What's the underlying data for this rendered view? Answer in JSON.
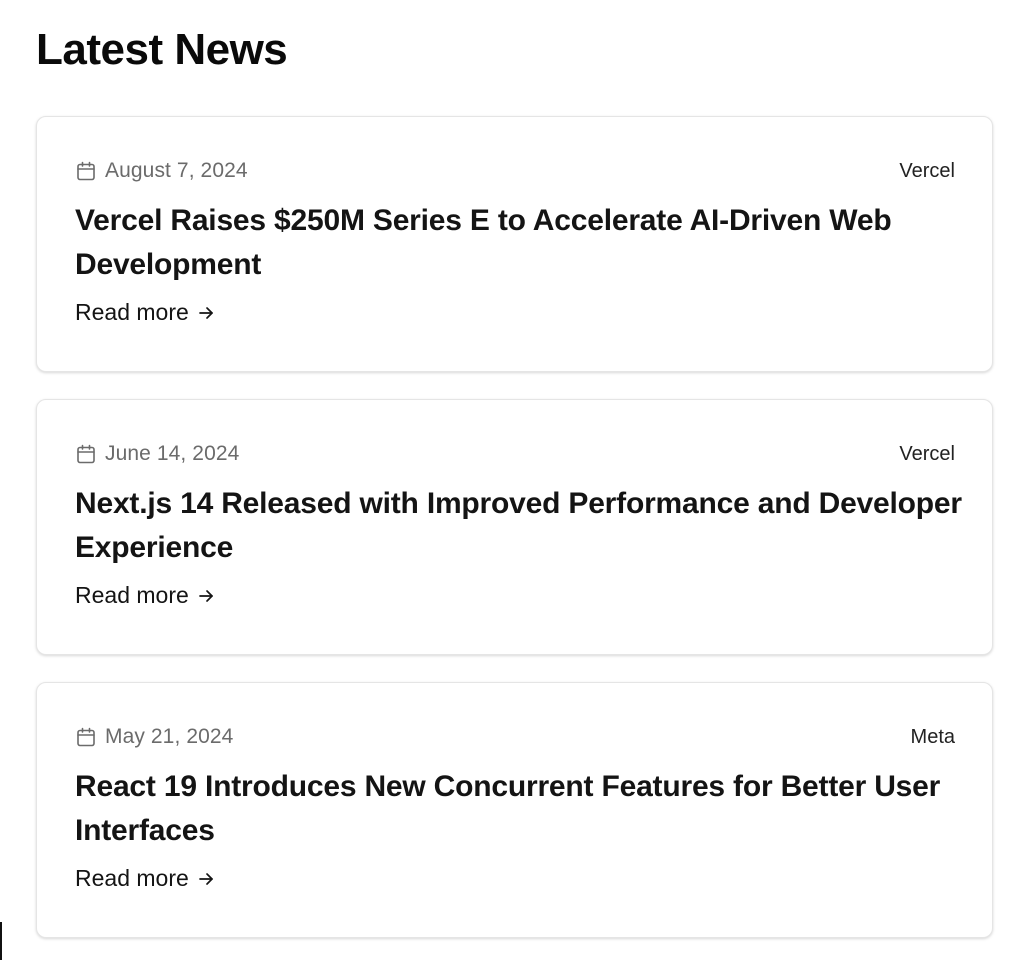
{
  "page": {
    "title": "Latest News"
  },
  "articles": [
    {
      "date": "August 7, 2024",
      "source": "Vercel",
      "headline": "Vercel Raises $250M Series E to Accelerate AI-Driven Web Development",
      "link_label": "Read more"
    },
    {
      "date": "June 14, 2024",
      "source": "Vercel",
      "headline": "Next.js 14 Released with Improved Performance and Developer Experience",
      "link_label": "Read more"
    },
    {
      "date": "May 21, 2024",
      "source": "Meta",
      "headline": "React 19 Introduces New Concurrent Features for Better User Interfaces",
      "link_label": "Read more"
    }
  ],
  "icons": {
    "date": "calendar-icon",
    "link": "arrow-right-icon"
  }
}
